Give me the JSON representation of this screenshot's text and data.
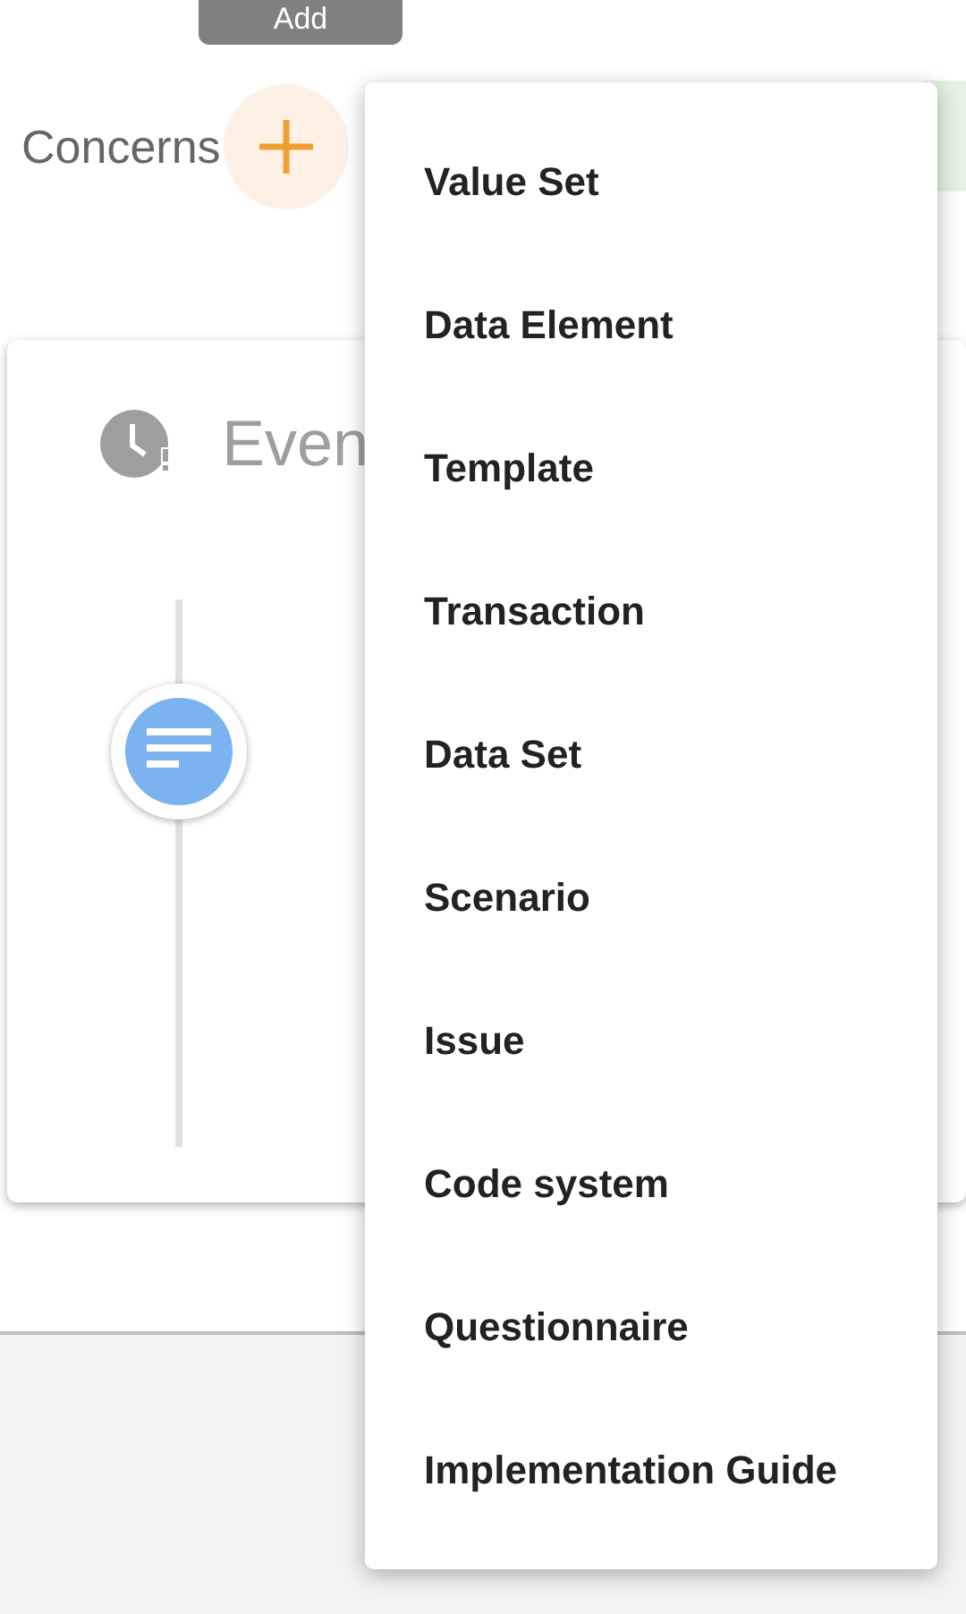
{
  "tooltip": {
    "label": "Add"
  },
  "concerns": {
    "label": "Concerns"
  },
  "events_card": {
    "title": "Even"
  },
  "menu": {
    "items": [
      {
        "label": "Value Set"
      },
      {
        "label": "Data Element"
      },
      {
        "label": "Template"
      },
      {
        "label": "Transaction"
      },
      {
        "label": "Data Set"
      },
      {
        "label": "Scenario"
      },
      {
        "label": "Issue"
      },
      {
        "label": "Code system"
      },
      {
        "label": "Questionnaire"
      },
      {
        "label": "Implementation Guide"
      }
    ]
  }
}
